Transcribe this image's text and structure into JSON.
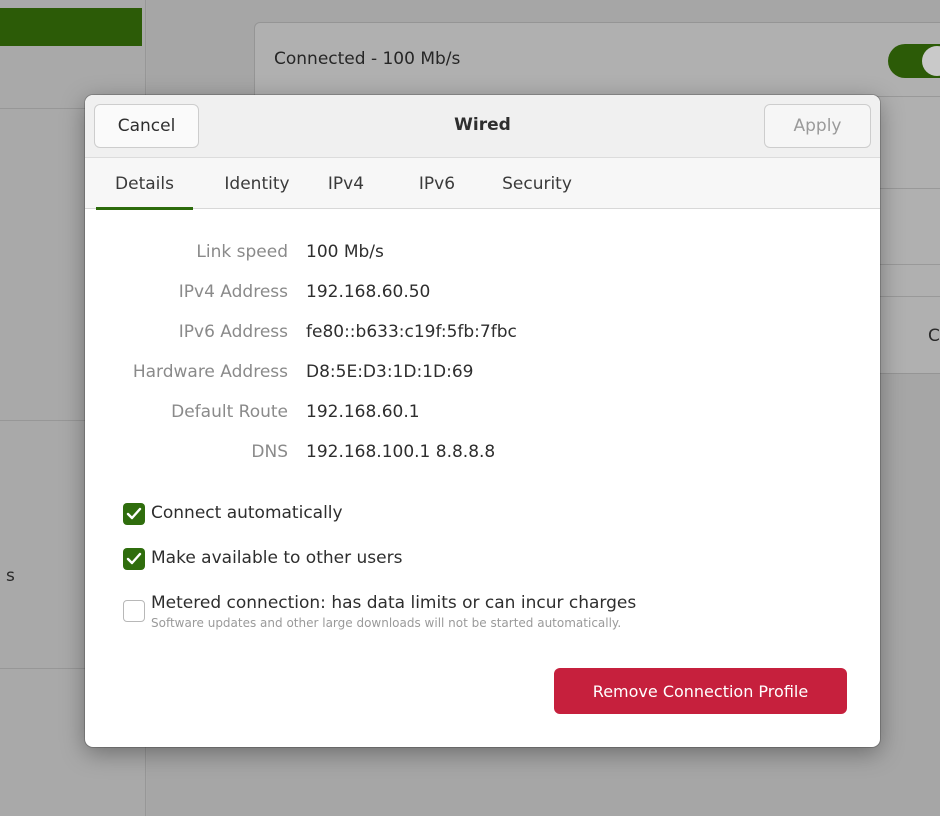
{
  "background": {
    "status_text": "Connected - 100 Mb/s",
    "sidebar_partial_text": "s",
    "edge_partial_text": "C",
    "toggle_on": true
  },
  "dialog": {
    "title": "Wired",
    "cancel_label": "Cancel",
    "apply_label": "Apply",
    "tabs": [
      {
        "label": "Details",
        "active": true
      },
      {
        "label": "Identity",
        "active": false
      },
      {
        "label": "IPv4",
        "active": false
      },
      {
        "label": "IPv6",
        "active": false
      },
      {
        "label": "Security",
        "active": false
      }
    ],
    "details": [
      {
        "label": "Link speed",
        "value": "100 Mb/s"
      },
      {
        "label": "IPv4 Address",
        "value": "192.168.60.50"
      },
      {
        "label": "IPv6 Address",
        "value": "fe80::b633:c19f:5fb:7fbc"
      },
      {
        "label": "Hardware Address",
        "value": "D8:5E:D3:1D:1D:69"
      },
      {
        "label": "Default Route",
        "value": "192.168.60.1"
      },
      {
        "label": "DNS",
        "value": "192.168.100.1 8.8.8.8"
      }
    ],
    "options": [
      {
        "label": "Connect automatically",
        "checked": true,
        "sub": ""
      },
      {
        "label": "Make available to other users",
        "checked": true,
        "sub": ""
      },
      {
        "label": "Metered connection: has data limits or can incur charges",
        "checked": false,
        "sub": "Software updates and other large downloads will not be started automatically."
      }
    ],
    "remove_label": "Remove Connection Profile"
  },
  "colors": {
    "accent": "#2c6b0b",
    "destructive": "#c6203d"
  }
}
